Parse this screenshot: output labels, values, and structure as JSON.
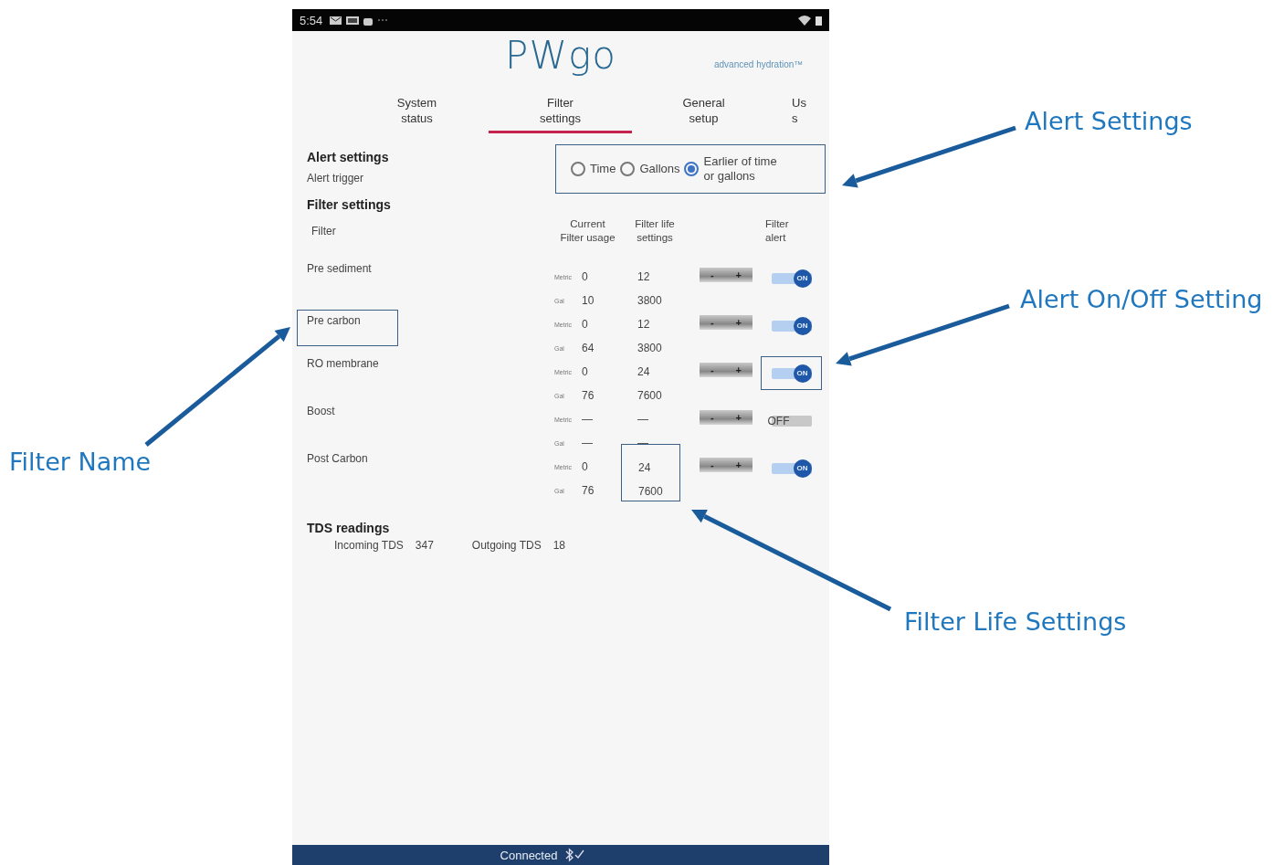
{
  "status_bar": {
    "time": "5:54"
  },
  "app": {
    "logo": "PWgo",
    "tagline": "advanced hydration™"
  },
  "tabs": [
    {
      "lines": [
        "System",
        "status"
      ],
      "selected": false
    },
    {
      "lines": [
        "Filter",
        "settings"
      ],
      "selected": true
    },
    {
      "lines": [
        "General",
        "setup"
      ],
      "selected": false
    },
    {
      "lines": [
        "Us",
        "s"
      ],
      "selected": false
    }
  ],
  "alert_settings": {
    "title": "Alert settings",
    "trigger_label": "Alert trigger",
    "highlighted": true,
    "options": [
      {
        "label": "Time",
        "selected": false
      },
      {
        "label": "Gallons",
        "selected": false
      },
      {
        "label": "Earlier of time or gallons",
        "selected": true
      }
    ]
  },
  "filter_settings": {
    "title": "Filter settings",
    "filter_label": "Filter",
    "columns": [
      {
        "lines": [
          "Current",
          "Filter usage"
        ]
      },
      {
        "lines": [
          "Filter life",
          "settings"
        ]
      },
      {
        "lines": [
          "Filter",
          "alert"
        ]
      }
    ],
    "filters": [
      {
        "name": "Pre sediment",
        "highlighted": false,
        "metric": {
          "unit": "Metric",
          "current": "0",
          "life": "12"
        },
        "gal": {
          "unit": "Gal",
          "current": "10",
          "life": "3800"
        },
        "life_highlighted": false,
        "stepper": {
          "minus": "-",
          "plus": "+"
        },
        "alert": {
          "on": true,
          "label": "ON",
          "highlighted": false
        }
      },
      {
        "name": "Pre carbon",
        "highlighted": true,
        "metric": {
          "unit": "Metric",
          "current": "0",
          "life": "12"
        },
        "gal": {
          "unit": "Gal",
          "current": "64",
          "life": "3800"
        },
        "life_highlighted": false,
        "stepper": {
          "minus": "-",
          "plus": "+"
        },
        "alert": {
          "on": true,
          "label": "ON",
          "highlighted": false
        }
      },
      {
        "name": "RO membrane",
        "highlighted": false,
        "metric": {
          "unit": "Metric",
          "current": "0",
          "life": "24"
        },
        "gal": {
          "unit": "Gal",
          "current": "76",
          "life": "7600"
        },
        "life_highlighted": false,
        "stepper": {
          "minus": "-",
          "plus": "+"
        },
        "alert": {
          "on": true,
          "label": "ON",
          "highlighted": true
        }
      },
      {
        "name": "Boost",
        "highlighted": false,
        "metric": {
          "unit": "Metric",
          "current": "—",
          "life": "—"
        },
        "gal": {
          "unit": "Gal",
          "current": "—",
          "life": "—"
        },
        "life_highlighted": false,
        "stepper": {
          "minus": "-",
          "plus": "+"
        },
        "alert": {
          "on": false,
          "label": "OFF",
          "highlighted": false
        }
      },
      {
        "name": "Post Carbon",
        "highlighted": false,
        "metric": {
          "unit": "Metric",
          "current": "0",
          "life": "24"
        },
        "gal": {
          "unit": "Gal",
          "current": "76",
          "life": "7600"
        },
        "life_highlighted": true,
        "stepper": {
          "minus": "-",
          "plus": "+"
        },
        "alert": {
          "on": true,
          "label": "ON",
          "highlighted": false
        }
      }
    ]
  },
  "tds": {
    "title": "TDS readings",
    "readings": [
      {
        "label": "Incoming TDS",
        "value": "347"
      },
      {
        "label": "Outgoing TDS",
        "value": "18"
      }
    ]
  },
  "bottom_bar": {
    "status": "Connected"
  },
  "annotations": [
    {
      "text": "Alert Settings"
    },
    {
      "text": "Alert On/Off Setting"
    },
    {
      "text": "Filter Name"
    },
    {
      "text": "Filter Life Settings"
    }
  ]
}
